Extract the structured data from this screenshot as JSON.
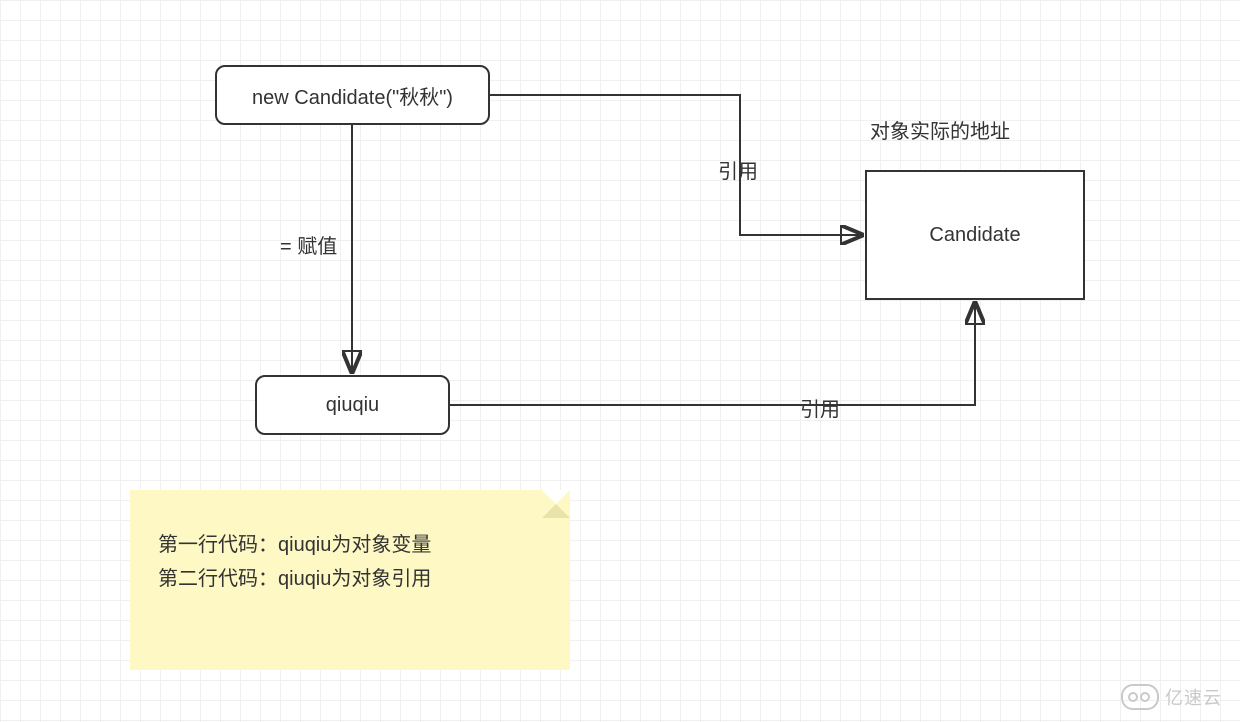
{
  "nodes": {
    "new_candidate": "new Candidate(\"秋秋\")",
    "qiuqiu": "qiuqiu",
    "candidate_obj": "Candidate"
  },
  "labels": {
    "assign": "= 赋值",
    "ref_top": "引用",
    "ref_bottom": "引用",
    "heap_title": "对象实际的地址"
  },
  "sticky": {
    "line1": "第一行代码：qiuqiu为对象变量",
    "line2": "第二行代码：qiuqiu为对象引用"
  },
  "watermark": "亿速云"
}
